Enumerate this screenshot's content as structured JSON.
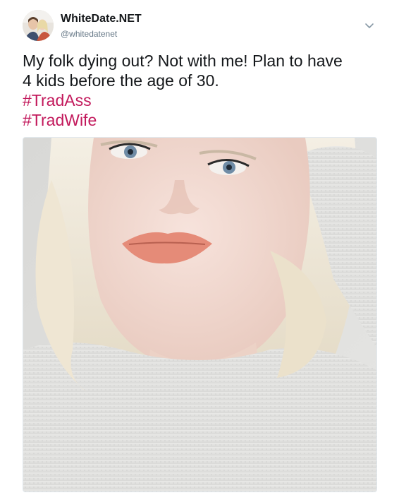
{
  "author": {
    "display_name": "WhiteDate.NET",
    "handle": "@whitedatenet"
  },
  "tweet": {
    "text_line1": "My folk dying out? Not with me! Plan to have",
    "text_line2": "4 kids before the age of 30.",
    "hashtags": [
      "#TradAss",
      "#TradWife"
    ]
  },
  "icons": {
    "menu": "chevron-down-icon"
  },
  "colors": {
    "hashtag": "#c2185b",
    "text": "#14171a",
    "secondary_text": "#657786",
    "border": "#e1e8ed"
  }
}
